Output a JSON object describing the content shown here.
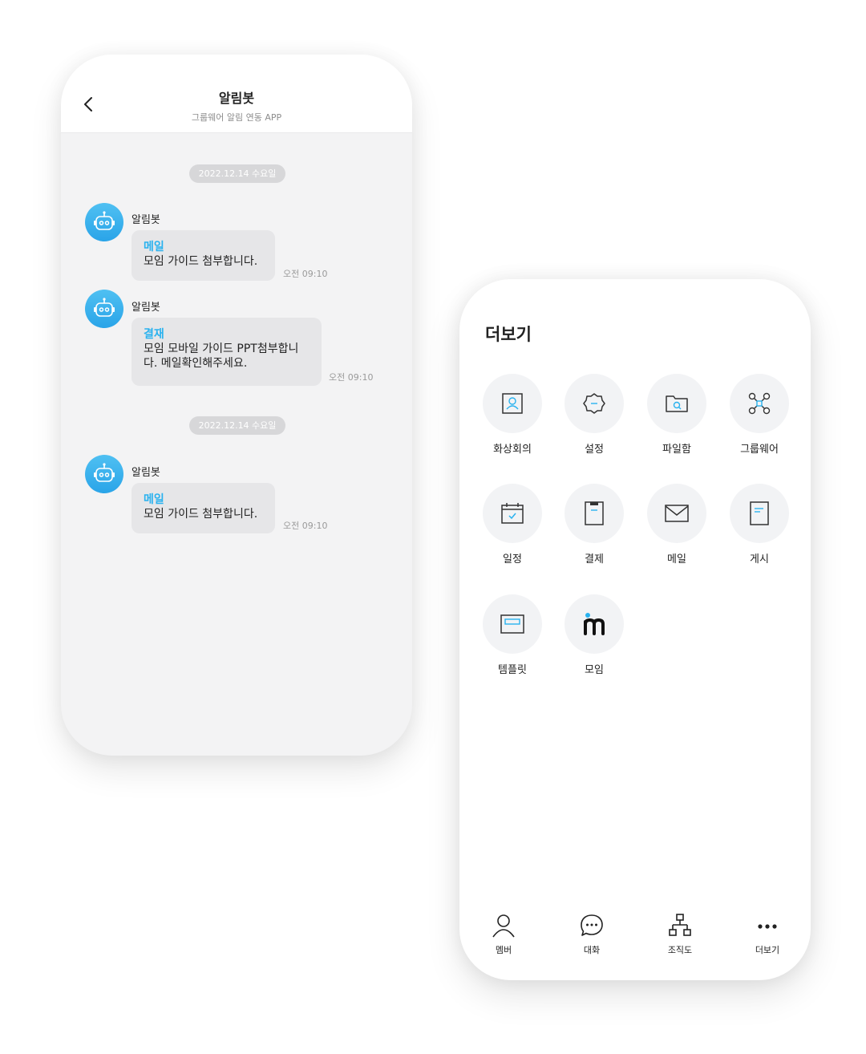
{
  "chat": {
    "title": "알림봇",
    "subtitle": "그룹웨어 알림 연동 APP",
    "date_pills": [
      "2022.12.14 수요일",
      "2022.12.14 수요일"
    ],
    "messages": [
      {
        "sender": "알림봇",
        "tag": "메일",
        "lines": [
          "모임 가이드 첨부합니다."
        ],
        "time": "오전 09:10"
      },
      {
        "sender": "알림봇",
        "tag": "결재",
        "lines": [
          "모임 모바일 가이드 PPT첨부합니",
          "다. 메일확인해주세요."
        ],
        "time": "오전 09:10"
      },
      {
        "sender": "알림봇",
        "tag": "메일",
        "lines": [
          "모임 가이드 첨부합니다."
        ],
        "time": "오전 09:10"
      }
    ],
    "icons": {
      "back": "chevron-left-icon",
      "avatar": "robot-icon"
    },
    "colors": {
      "accent": "#29b2ef",
      "background": "#f3f3f4",
      "bubble": "#e6e6e8"
    }
  },
  "more": {
    "title": "더보기",
    "items": [
      {
        "label": "화상회의",
        "icon": "video-conference-icon"
      },
      {
        "label": "설정",
        "icon": "settings-icon"
      },
      {
        "label": "파일함",
        "icon": "folder-search-icon"
      },
      {
        "label": "그룹웨어",
        "icon": "network-icon"
      },
      {
        "label": "일정",
        "icon": "calendar-icon"
      },
      {
        "label": "결제",
        "icon": "clipboard-icon"
      },
      {
        "label": "메일",
        "icon": "mail-icon"
      },
      {
        "label": "게시",
        "icon": "board-icon"
      },
      {
        "label": "템플릿",
        "icon": "template-icon"
      },
      {
        "label": "모임",
        "icon": "moim-logo-icon"
      }
    ],
    "tabs": [
      {
        "label": "멤버",
        "icon": "person-icon"
      },
      {
        "label": "대화",
        "icon": "chat-bubble-icon"
      },
      {
        "label": "조직도",
        "icon": "org-chart-icon"
      },
      {
        "label": "더보기",
        "icon": "more-dots-icon"
      }
    ]
  }
}
